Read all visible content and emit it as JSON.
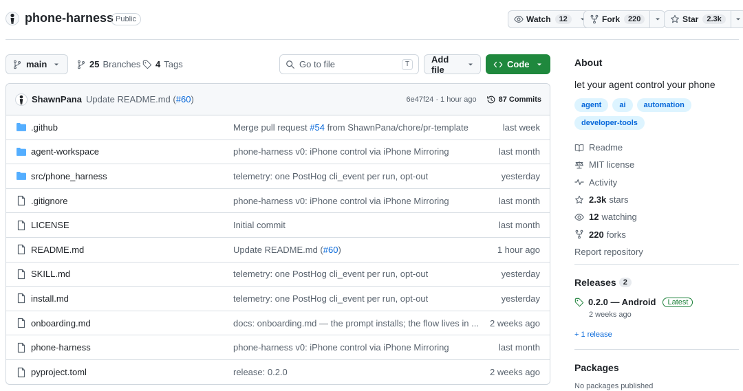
{
  "repo": {
    "name": "phone-harness",
    "visibility": "Public",
    "watch_label": "Watch",
    "watch_count": "12",
    "fork_label": "Fork",
    "fork_count": "220",
    "star_label": "Star",
    "star_count": "2.3k"
  },
  "toolbar": {
    "branch": "main",
    "branches_count": "25",
    "branches_label": "Branches",
    "tags_count": "4",
    "tags_label": "Tags",
    "goto_placeholder": "Go to file",
    "goto_key": "T",
    "add_file": "Add file",
    "code": "Code"
  },
  "latest_commit": {
    "author": "ShawnPana",
    "message": "Update README.md (",
    "pr": "#60",
    "message_end": ")",
    "sha": "6e47f24 · 1 hour ago",
    "commits": "87 Commits"
  },
  "files": [
    {
      "name": ".github",
      "type": "dir",
      "msg_pre": "Merge pull request ",
      "msg_link": "#54",
      "msg_post": " from ShawnPana/chore/pr-template",
      "date": "last week"
    },
    {
      "name": "agent-workspace",
      "type": "dir",
      "msg_pre": "phone-harness v0: iPhone control via iPhone Mirroring",
      "msg_link": "",
      "msg_post": "",
      "date": "last month"
    },
    {
      "name": "src/phone_harness",
      "type": "dir",
      "msg_pre": "telemetry: one PostHog cli_event per run, opt-out",
      "msg_link": "",
      "msg_post": "",
      "date": "yesterday"
    },
    {
      "name": ".gitignore",
      "type": "file",
      "msg_pre": "phone-harness v0: iPhone control via iPhone Mirroring",
      "msg_link": "",
      "msg_post": "",
      "date": "last month"
    },
    {
      "name": "LICENSE",
      "type": "file",
      "msg_pre": "Initial commit",
      "msg_link": "",
      "msg_post": "",
      "date": "last month"
    },
    {
      "name": "README.md",
      "type": "file",
      "msg_pre": "Update README.md (",
      "msg_link": "#60",
      "msg_post": ")",
      "date": "1 hour ago"
    },
    {
      "name": "SKILL.md",
      "type": "file",
      "msg_pre": "telemetry: one PostHog cli_event per run, opt-out",
      "msg_link": "",
      "msg_post": "",
      "date": "yesterday"
    },
    {
      "name": "install.md",
      "type": "file",
      "msg_pre": "telemetry: one PostHog cli_event per run, opt-out",
      "msg_link": "",
      "msg_post": "",
      "date": "yesterday"
    },
    {
      "name": "onboarding.md",
      "type": "file",
      "msg_pre": "docs: onboarding.md — the prompt installs; the flow lives in ...",
      "msg_link": "",
      "msg_post": "",
      "date": "2 weeks ago"
    },
    {
      "name": "phone-harness",
      "type": "file",
      "msg_pre": "phone-harness v0: iPhone control via iPhone Mirroring",
      "msg_link": "",
      "msg_post": "",
      "date": "last month"
    },
    {
      "name": "pyproject.toml",
      "type": "file",
      "msg_pre": "release: 0.2.0",
      "msg_link": "",
      "msg_post": "",
      "date": "2 weeks ago"
    }
  ],
  "about": {
    "heading": "About",
    "description": "let your agent control your phone",
    "topics": [
      "agent",
      "ai",
      "automation",
      "developer-tools"
    ],
    "readme": "Readme",
    "license": "MIT license",
    "activity": "Activity",
    "stars_count": "2.3k",
    "stars_label": "stars",
    "watching_count": "12",
    "watching_label": "watching",
    "forks_count": "220",
    "forks_label": "forks",
    "report": "Report repository"
  },
  "releases": {
    "heading": "Releases",
    "count": "2",
    "latest_name": "0.2.0 — Android",
    "latest_badge": "Latest",
    "latest_date": "2 weeks ago",
    "more": "+ 1 release"
  },
  "packages": {
    "heading": "Packages",
    "empty": "No packages published"
  },
  "colors": {
    "accent": "#0969da",
    "code_button": "#1f883d",
    "folder": "#54aeff"
  }
}
